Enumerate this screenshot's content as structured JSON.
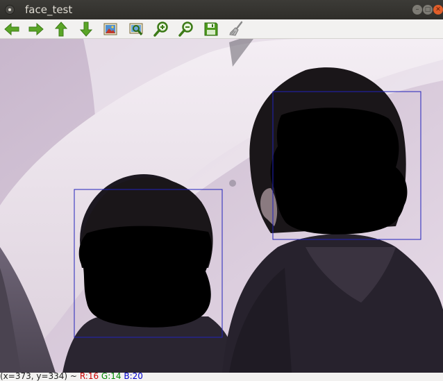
{
  "window": {
    "title": "face_test"
  },
  "toolbar": {
    "buttons": [
      {
        "name": "pan-left-button",
        "icon": "arrow-left-icon"
      },
      {
        "name": "pan-right-button",
        "icon": "arrow-right-icon"
      },
      {
        "name": "pan-up-button",
        "icon": "arrow-up-icon"
      },
      {
        "name": "pan-down-button",
        "icon": "arrow-down-icon"
      },
      {
        "name": "zoom-x1-button",
        "icon": "image-icon"
      },
      {
        "name": "zoom-fit-button",
        "icon": "zoom-region-icon"
      },
      {
        "name": "zoom-in-button",
        "icon": "zoom-in-icon"
      },
      {
        "name": "zoom-out-button",
        "icon": "zoom-out-icon"
      },
      {
        "name": "save-image-button",
        "icon": "save-icon"
      },
      {
        "name": "properties-button",
        "icon": "brush-icon"
      }
    ]
  },
  "detections": [
    {
      "label": "face-box-left"
    },
    {
      "label": "face-box-right"
    }
  ],
  "colors": {
    "box": "#2222bb",
    "icon_green": "#5aa527"
  },
  "status": {
    "coords": "(x=373, y=334) ~",
    "r": "R:16",
    "g": "G:14",
    "b": "B:20"
  }
}
